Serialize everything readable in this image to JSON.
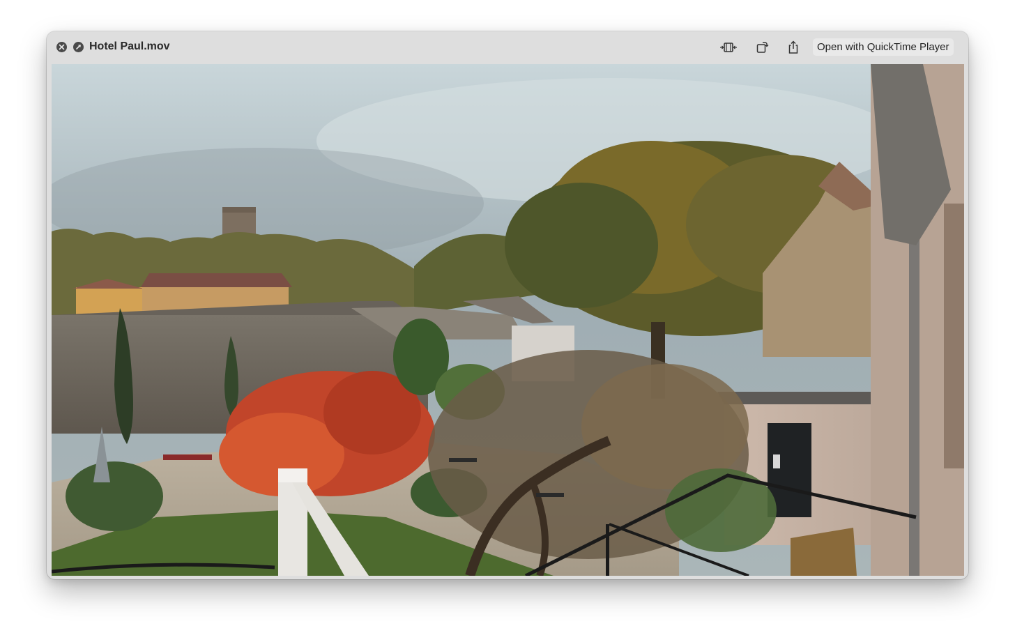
{
  "window": {
    "title": "Hotel Paul.mov"
  },
  "titlebar_buttons": {
    "close_icon": "close-icon",
    "fullscreen_icon": "fullscreen-icon"
  },
  "toolbar": {
    "trim_icon": "trim-icon",
    "rotate_icon": "rotate-icon",
    "share_icon": "share-icon",
    "open_with_label": "Open with QuickTime Player"
  },
  "video": {
    "scene": "video-frame"
  }
}
